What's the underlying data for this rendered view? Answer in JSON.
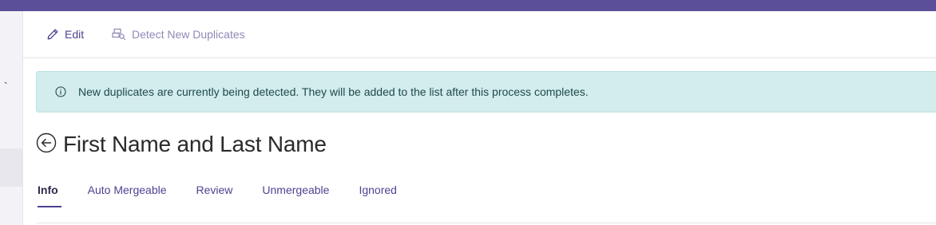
{
  "colors": {
    "brand": "#5a4f98",
    "link": "#4d4391",
    "link_muted": "#8f89b6",
    "alert_bg": "#d3ecec",
    "alert_text": "#1f4a4c"
  },
  "left_rail": {
    "glyph": "`"
  },
  "toolbar": {
    "edit_label": "Edit",
    "edit_icon": "pencil-icon",
    "detect_label": "Detect New Duplicates",
    "detect_icon": "detect-duplicates-icon"
  },
  "alert": {
    "icon": "info-circle-icon",
    "message": "New duplicates are currently being detected. They will be added to the list after this process completes."
  },
  "header": {
    "back_icon": "back-arrow-circle-icon",
    "title": "First Name and Last Name"
  },
  "tabs": [
    {
      "label": "Info",
      "active": true
    },
    {
      "label": "Auto Mergeable",
      "active": false
    },
    {
      "label": "Review",
      "active": false
    },
    {
      "label": "Unmergeable",
      "active": false
    },
    {
      "label": "Ignored",
      "active": false
    }
  ]
}
